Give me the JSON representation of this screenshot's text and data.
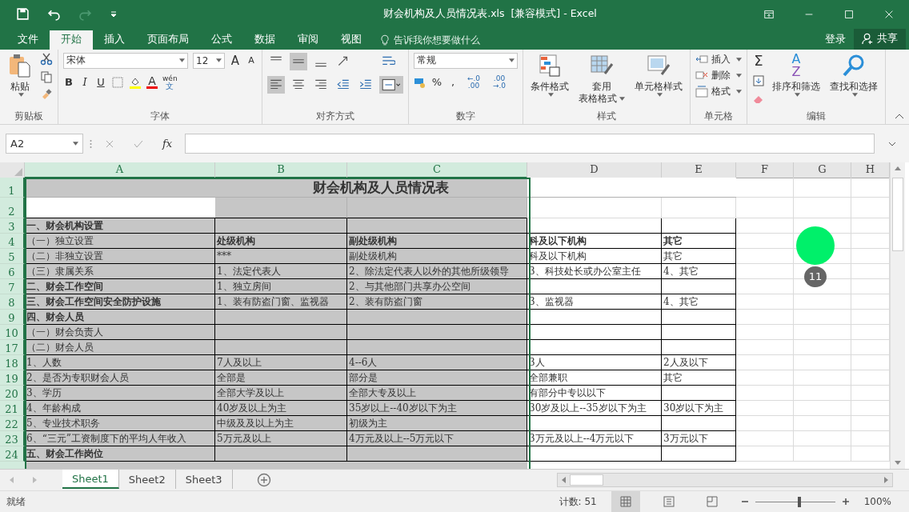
{
  "title_bar": {
    "title": "财会机构及人员情况表.xls  [兼容模式] - Excel"
  },
  "menu_tabs": [
    {
      "label": "文件",
      "selected": false
    },
    {
      "label": "开始",
      "selected": true
    },
    {
      "label": "插入",
      "selected": false
    },
    {
      "label": "页面布局",
      "selected": false
    },
    {
      "label": "公式",
      "selected": false
    },
    {
      "label": "数据",
      "selected": false
    },
    {
      "label": "审阅",
      "selected": false
    },
    {
      "label": "视图",
      "selected": false
    }
  ],
  "tell_me": {
    "placeholder": "告诉我你想要做什么"
  },
  "sign_in": "登录",
  "share": "共享",
  "ribbon": {
    "clipboard": {
      "paste": "粘贴",
      "group": "剪贴板"
    },
    "font": {
      "name": "宋体",
      "size": "12",
      "grow": "A",
      "shrink": "A",
      "bold": "B",
      "italic": "I",
      "underline": "U",
      "font_color": "A",
      "phonetic_top": "wén",
      "phonetic_bottom": "文",
      "group": "字体"
    },
    "alignment": {
      "group": "对齐方式"
    },
    "number": {
      "format": "常规",
      "percent": "%",
      "comma": ",",
      "increase_decimal": "←.0 .00",
      "decrease_decimal": ".00 →.0",
      "group": "数字"
    },
    "styles": {
      "conditional": "条件格式",
      "table_format_1": "套用",
      "table_format_2": "表格格式",
      "cell_styles": "单元格样式",
      "group": "样式"
    },
    "cells": {
      "insert": "插入",
      "delete": "删除",
      "format": "格式",
      "group": "单元格"
    },
    "editing": {
      "autosum": "Σ",
      "sort_a": "A",
      "sort_z": "Z",
      "sort_filter": "排序和筛选",
      "find_select": "查找和选择",
      "group": "编辑"
    }
  },
  "formula_bar": {
    "name_box": "A2",
    "fx": "fx"
  },
  "columns": [
    {
      "label": "A",
      "selected": true
    },
    {
      "label": "B",
      "selected": true
    },
    {
      "label": "C",
      "selected": true
    },
    {
      "label": "D",
      "selected": false
    },
    {
      "label": "E",
      "selected": false
    },
    {
      "label": "F",
      "selected": false
    },
    {
      "label": "G",
      "selected": false
    },
    {
      "label": "H",
      "selected": false
    }
  ],
  "rows": [
    {
      "number": "1",
      "kind": "title",
      "title": "财会机构及人员情况表"
    },
    {
      "number": "2",
      "kind": "blank"
    },
    {
      "number": "3",
      "kind": "data",
      "cells": [
        {
          "text": "一、财会机构设置",
          "bold": true
        },
        null,
        null,
        null,
        null
      ]
    },
    {
      "number": "4",
      "kind": "data",
      "cells": [
        {
          "text": "（一）独立设置",
          "bold": false
        },
        {
          "text": "处级机构",
          "bold": true
        },
        {
          "text": "副处级机构",
          "bold": true
        },
        {
          "text": "科及以下机构",
          "bold": true
        },
        {
          "text": "其它",
          "bold": true
        }
      ]
    },
    {
      "number": "5",
      "kind": "data",
      "cells": [
        {
          "text": "（二）非独立设置",
          "bold": false
        },
        {
          "text": "***",
          "bold": false
        },
        {
          "text": "副处级机构",
          "bold": false
        },
        {
          "text": "科及以下机构",
          "bold": false
        },
        {
          "text": "其它",
          "bold": false
        }
      ]
    },
    {
      "number": "6",
      "kind": "data",
      "cells": [
        {
          "text": "（三）隶属关系",
          "bold": false
        },
        {
          "text": "1、法定代表人",
          "bold": false
        },
        {
          "text": "2、除法定代表人以外的其他所级领导",
          "bold": false
        },
        {
          "text": "3、科技处长或办公室主任",
          "bold": false
        },
        {
          "text": "4、其它",
          "bold": false
        }
      ]
    },
    {
      "number": "7",
      "kind": "data",
      "cells": [
        {
          "text": "二、财会工作空间",
          "bold": true
        },
        {
          "text": "1、独立房间",
          "bold": false
        },
        {
          "text": "2、与其他部门共享办公空间",
          "bold": false
        },
        null,
        null
      ]
    },
    {
      "number": "8",
      "kind": "data",
      "cells": [
        {
          "text": "三、财会工作空间安全防护设施",
          "bold": true
        },
        {
          "text": "1、装有防盗门窗、监视器",
          "bold": false
        },
        {
          "text": "2、装有防盗门窗",
          "bold": false
        },
        {
          "text": "3、监视器",
          "bold": false
        },
        {
          "text": "4、其它",
          "bold": false
        }
      ]
    },
    {
      "number": "9",
      "kind": "data",
      "cells": [
        {
          "text": "四、财会人员",
          "bold": true
        },
        null,
        null,
        null,
        null
      ]
    },
    {
      "number": "10",
      "kind": "data",
      "cells": [
        {
          "text": "（一）财会负责人",
          "bold": false
        },
        null,
        null,
        null,
        null
      ]
    },
    {
      "number": "17",
      "kind": "data",
      "cells": [
        {
          "text": "（二）财会人员",
          "bold": false
        },
        null,
        null,
        null,
        null
      ]
    },
    {
      "number": "18",
      "kind": "data",
      "cells": [
        {
          "text": "1、人数",
          "bold": false
        },
        {
          "text": "7人及以上",
          "bold": false
        },
        {
          "text": "4--6人",
          "bold": false
        },
        {
          "text": "3人",
          "bold": false
        },
        {
          "text": "2人及以下",
          "bold": false
        }
      ]
    },
    {
      "number": "19",
      "kind": "data",
      "cells": [
        {
          "text": "2、是否为专职财会人员",
          "bold": false
        },
        {
          "text": "全部是",
          "bold": false
        },
        {
          "text": "部分是",
          "bold": false
        },
        {
          "text": "全部兼职",
          "bold": false
        },
        {
          "text": "其它",
          "bold": false
        }
      ]
    },
    {
      "number": "20",
      "kind": "data",
      "cells": [
        {
          "text": "3、学历",
          "bold": false
        },
        {
          "text": "全部大学及以上",
          "bold": false
        },
        {
          "text": "全部大专及以上",
          "bold": false
        },
        {
          "text": "有部分中专以以下",
          "bold": false
        },
        null
      ]
    },
    {
      "number": "21",
      "kind": "data",
      "cells": [
        {
          "text": "4、年龄构成",
          "bold": false
        },
        {
          "text": "40岁及以上为主",
          "bold": false
        },
        {
          "text": "35岁以上--40岁以下为主",
          "bold": false
        },
        {
          "text": "30岁及以上--35岁以下为主",
          "bold": false
        },
        {
          "text": "30岁以下为主",
          "bold": false
        }
      ]
    },
    {
      "number": "22",
      "kind": "data",
      "cells": [
        {
          "text": "5、专业技术职务",
          "bold": false
        },
        {
          "text": "中级及及以上为主",
          "bold": false
        },
        {
          "text": "初级为主",
          "bold": false
        },
        null,
        null
      ]
    },
    {
      "number": "23",
      "kind": "data",
      "cells": [
        {
          "text": "6、“三元”工资制度下的平均人年收入",
          "bold": false
        },
        {
          "text": "5万元及以上",
          "bold": false
        },
        {
          "text": "4万元及以上--5万元以下",
          "bold": false
        },
        {
          "text": "3万元及以上--4万元以下",
          "bold": false
        },
        {
          "text": "3万元以下",
          "bold": false
        }
      ]
    },
    {
      "number": "24",
      "kind": "data",
      "cells": [
        {
          "text": "五、财会工作岗位",
          "bold": true
        },
        null,
        null,
        null,
        null
      ]
    }
  ],
  "sheet_tabs": [
    {
      "label": "Sheet1",
      "selected": true
    },
    {
      "label": "Sheet2",
      "selected": false
    },
    {
      "label": "Sheet3",
      "selected": false
    }
  ],
  "status_bar": {
    "ready": "就绪",
    "count": "计数: 51",
    "zoom": {
      "level": 0.55
    },
    "zoom_label": "100%"
  },
  "click_marker": {
    "label": "11"
  }
}
